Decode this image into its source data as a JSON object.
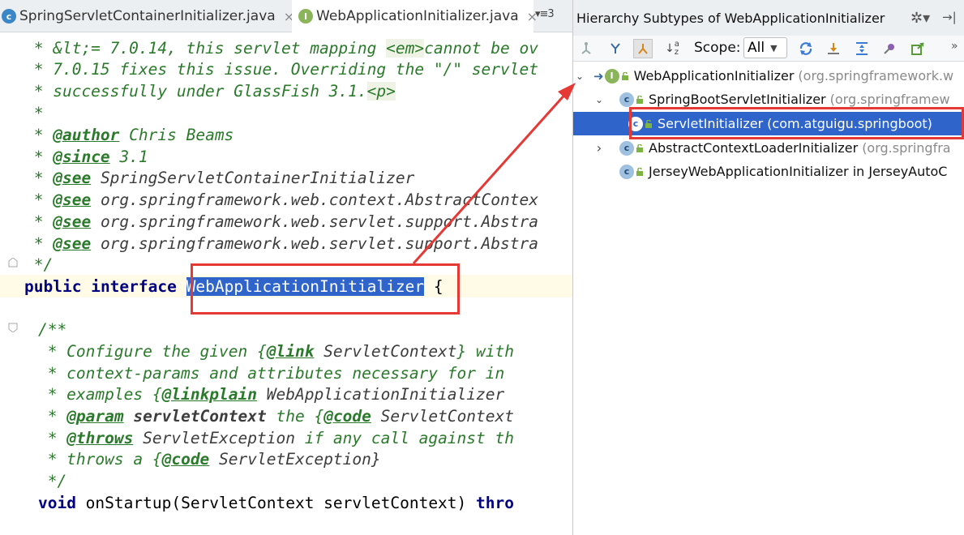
{
  "editor": {
    "tabs": [
      {
        "label": "SpringServletContainerInitializer.java",
        "icon": "class-c-icon",
        "close": "×"
      },
      {
        "label": "WebApplicationInitializer.java",
        "icon": "interface-i-icon",
        "close": "×"
      }
    ],
    "tab_list_button": "▾≡3",
    "code": {
      "l1a": " * &lt;= 7.0.14, this servlet mapping ",
      "l1b": "<em>",
      "l1c": "cannot be ov",
      "l2": " * 7.0.15 fixes this issue. Overriding the \"/\" servlet",
      "l3a": " * successfully under GlassFish 3.1.",
      "l3b": "<p>",
      "l4": " *",
      "l5a": " * ",
      "l5b": "@author",
      "l5c": " Chris Beams",
      "l6a": " * ",
      "l6b": "@since",
      "l6c": " 3.1",
      "l7a": " * ",
      "l7b": "@see",
      "l7c": " SpringServletContainerInitializer",
      "l8a": " * ",
      "l8b": "@see",
      "l8c": " org.springframework.web.context.AbstractContex",
      "l9a": " * ",
      "l9b": "@see",
      "l9c": " org.springframework.web.servlet.support.Abstra",
      "l10a": " * ",
      "l10b": "@see",
      "l10c": " org.springframework.web.servlet.support.Abstra",
      "l11": " */",
      "l12a": "public",
      "l12b": " ",
      "l12c": "interface",
      "l12d": " ",
      "l12e": "WebApplicationInitializer",
      "l12f": " {",
      "l14": "    /**",
      "l15a": "     * Configure the given {",
      "l15b": "@link",
      "l15c": " ServletContext",
      "l15d": "} with",
      "l16": "     * context-params and attributes necessary for in",
      "l17a": "     * examples {",
      "l17b": "@linkplain",
      "l17c": " WebApplicationInitializer",
      "l18a": "     * ",
      "l18b": "@param",
      "l18c": " servletContext",
      "l18d": " the {",
      "l18e": "@code",
      "l18f": " ServletContext",
      "l19a": "     * ",
      "l19b": "@throws",
      "l19c": " ServletException",
      "l19d": " if any call against th",
      "l20a": "     * throws a {",
      "l20b": "@code",
      "l20c": " ServletException}",
      "l21": "     */",
      "l22a": "    ",
      "l22b": "void",
      "l22c": " onStartup(ServletContext servletContext) ",
      "l22d": "thro"
    }
  },
  "hierarchy": {
    "title": "Hierarchy Subtypes of WebApplicationInitializer",
    "gear": "✲▾",
    "pin": "→|",
    "toolbar": {
      "scope_label": "Scope:",
      "scope_value": "All",
      "more": "»"
    },
    "nodes": [
      {
        "name": "WebApplicationInitializer",
        "pkg": "(org.springframework.w",
        "icon": "interface-i-icon",
        "arrow": "⌄"
      },
      {
        "name": "SpringBootServletInitializer",
        "pkg": "(org.springframew",
        "icon": "class-c-icon",
        "arrow": "⌄"
      },
      {
        "name": "ServletInitializer",
        "pkg": "(com.atguigu.springboot)",
        "icon": "class-c-icon",
        "arrow": ""
      },
      {
        "name": "AbstractContextLoaderInitializer",
        "pkg": "(org.springfra",
        "icon": "abstract-class-icon",
        "arrow": "›"
      },
      {
        "name": "JerseyWebApplicationInitializer in JerseyAutoC",
        "pkg": "",
        "icon": "inner-class-icon",
        "arrow": ""
      }
    ]
  },
  "colors": {
    "selection": "#2f65ca",
    "annotation_red": "#e53935",
    "doc_green": "#2b7a2b",
    "keyword_navy": "#000080"
  }
}
